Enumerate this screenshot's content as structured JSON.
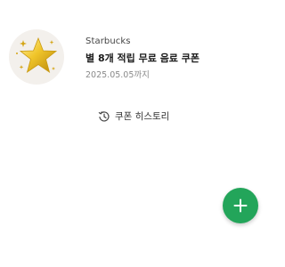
{
  "coupon": {
    "brand": "Starbucks",
    "title": "별 8개 적립 무료 음료 쿠폰",
    "expiry": "2025.05.05까지",
    "logo_icon": "gold-star-icon"
  },
  "history": {
    "label": "쿠폰 히스토리",
    "icon": "history-clock-icon"
  },
  "fab": {
    "icon": "plus-icon",
    "color": "#23a55a"
  },
  "colors": {
    "accent": "#23a55a",
    "star_gold": "#e6b820",
    "logo_bg": "#f3f0ec"
  }
}
